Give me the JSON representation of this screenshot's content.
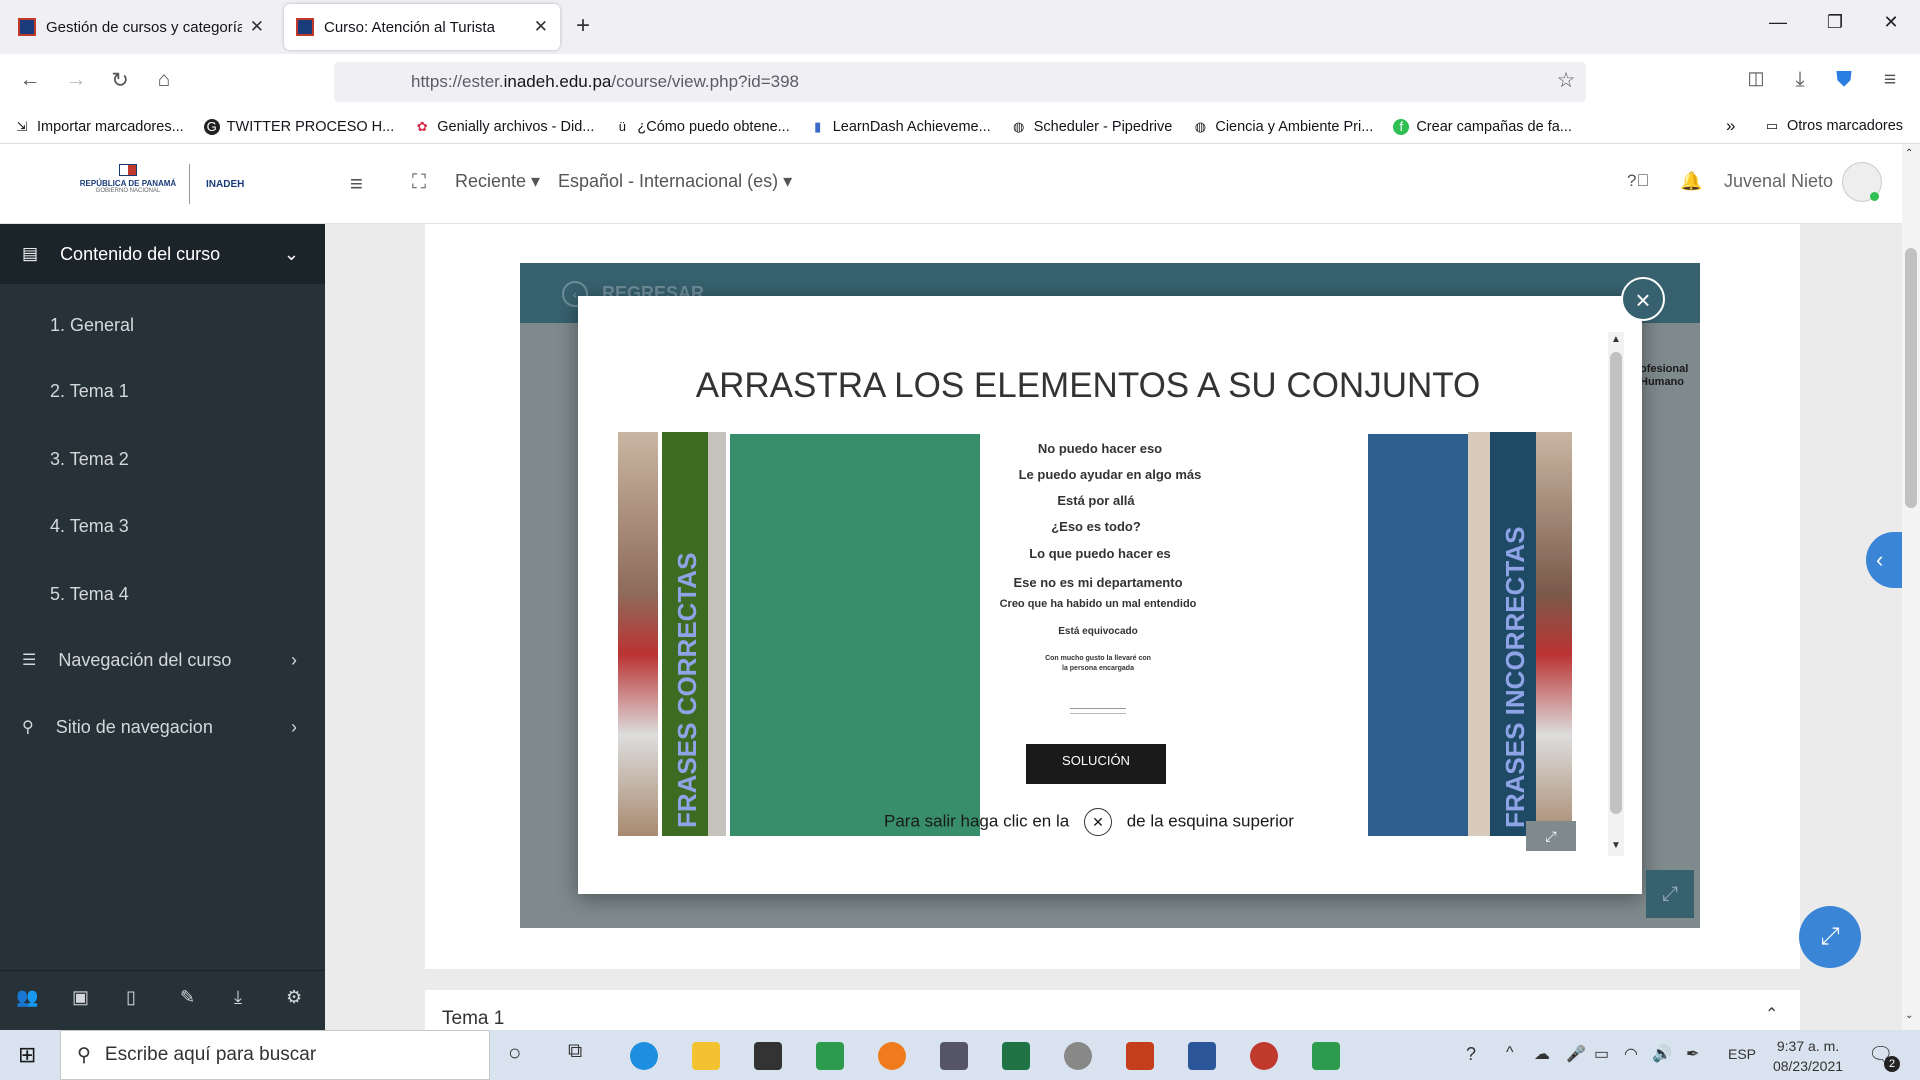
{
  "browser": {
    "tabs": [
      {
        "title": "Gestión de cursos y categorías",
        "active": false
      },
      {
        "title": "Curso: Atención al Turista",
        "active": true
      }
    ],
    "url_prefix": "https://ester.",
    "url_domain": "inadeh.edu.pa",
    "url_path": "/course/view.php?id=398",
    "bookmarks": [
      {
        "label": "Importar marcadores...",
        "icon": "import-icon"
      },
      {
        "label": "TWITTER PROCESO H...",
        "icon": "google-icon"
      },
      {
        "label": "Genially archivos - Did...",
        "icon": "genially-icon"
      },
      {
        "label": "¿Cómo puedo obtene...",
        "icon": "unicorn-icon"
      },
      {
        "label": "LearnDash Achieveme...",
        "icon": "bar-chart-icon"
      },
      {
        "label": "Scheduler - Pipedrive",
        "icon": "globe-icon"
      },
      {
        "label": "Ciencia y Ambiente Pri...",
        "icon": "globe-icon"
      },
      {
        "label": "Crear campañas de fa...",
        "icon": "green-circle-icon"
      }
    ],
    "other_bookmarks": "Otros marcadores"
  },
  "header": {
    "logo_left": "REPÚBLICA DE PANAMÁ",
    "logo_sub": "GOBIERNO NACIONAL",
    "logo_right": "INADEH",
    "recent": "Reciente",
    "language": "Español - Internacional (es)",
    "user": "Juvenal Nieto"
  },
  "sidebar": {
    "section1": "Contenido del curso",
    "items": [
      "1. General",
      "2. Tema 1",
      "3. Tema 2",
      "4. Tema 3",
      "5. Tema 4"
    ],
    "section2": "Navegación del curso",
    "section3": "Sitio de navegacion"
  },
  "activity": {
    "back_label": "REGRESAR",
    "side_text_1": "ofesional",
    "side_text_2": "Humano",
    "title": "ARRASTRA LOS ELEMENTOS A SU CONJUNTO",
    "left_set": "FRASES CORRECTAS",
    "right_set": "FRASES INCORRECTAS",
    "phrases": [
      "No puedo hacer eso",
      "Le puedo ayudar en algo más",
      "Está por allá",
      "¿Eso es todo?",
      "Lo que puedo hacer es",
      "Ese no es mi departamento",
      "Creo que ha habido un mal entendido",
      "Está equivocado",
      "Con mucho gusto la llevaré con",
      "la persona encargada"
    ],
    "solution_button": "SOLUCIÓN",
    "exit_text_1": "Para salir haga clic en la",
    "exit_text_2": "de la esquina superior"
  },
  "main": {
    "next_section": "Tema 1"
  },
  "taskbar": {
    "search_placeholder": "Escribe aquí para buscar",
    "lang": "ESP",
    "time": "9:37 a. m.",
    "date": "08/23/2021",
    "notifications": "2"
  }
}
